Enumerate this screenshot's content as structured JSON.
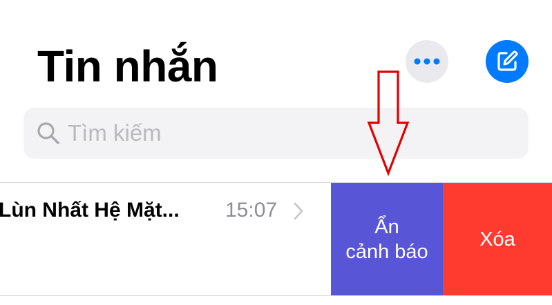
{
  "header": {
    "title": "Tin nhắn",
    "more_icon": "ellipsis-icon",
    "compose_icon": "compose-icon"
  },
  "search": {
    "placeholder": "Tìm kiếm",
    "icon": "search-icon"
  },
  "conversation": {
    "contact_name": "Lùn Nhất Hệ Mặt...",
    "time": "15:07",
    "chevron_icon": "chevron-right-icon"
  },
  "swipe_actions": {
    "hide_alerts_line1": "Ẩn",
    "hide_alerts_line2": "cảnh báo",
    "delete_label": "Xóa"
  },
  "colors": {
    "accent_blue": "#007aff",
    "hide_alerts_purple": "#5856d6",
    "delete_red": "#ff3b30",
    "annotation_red": "#e00000"
  }
}
